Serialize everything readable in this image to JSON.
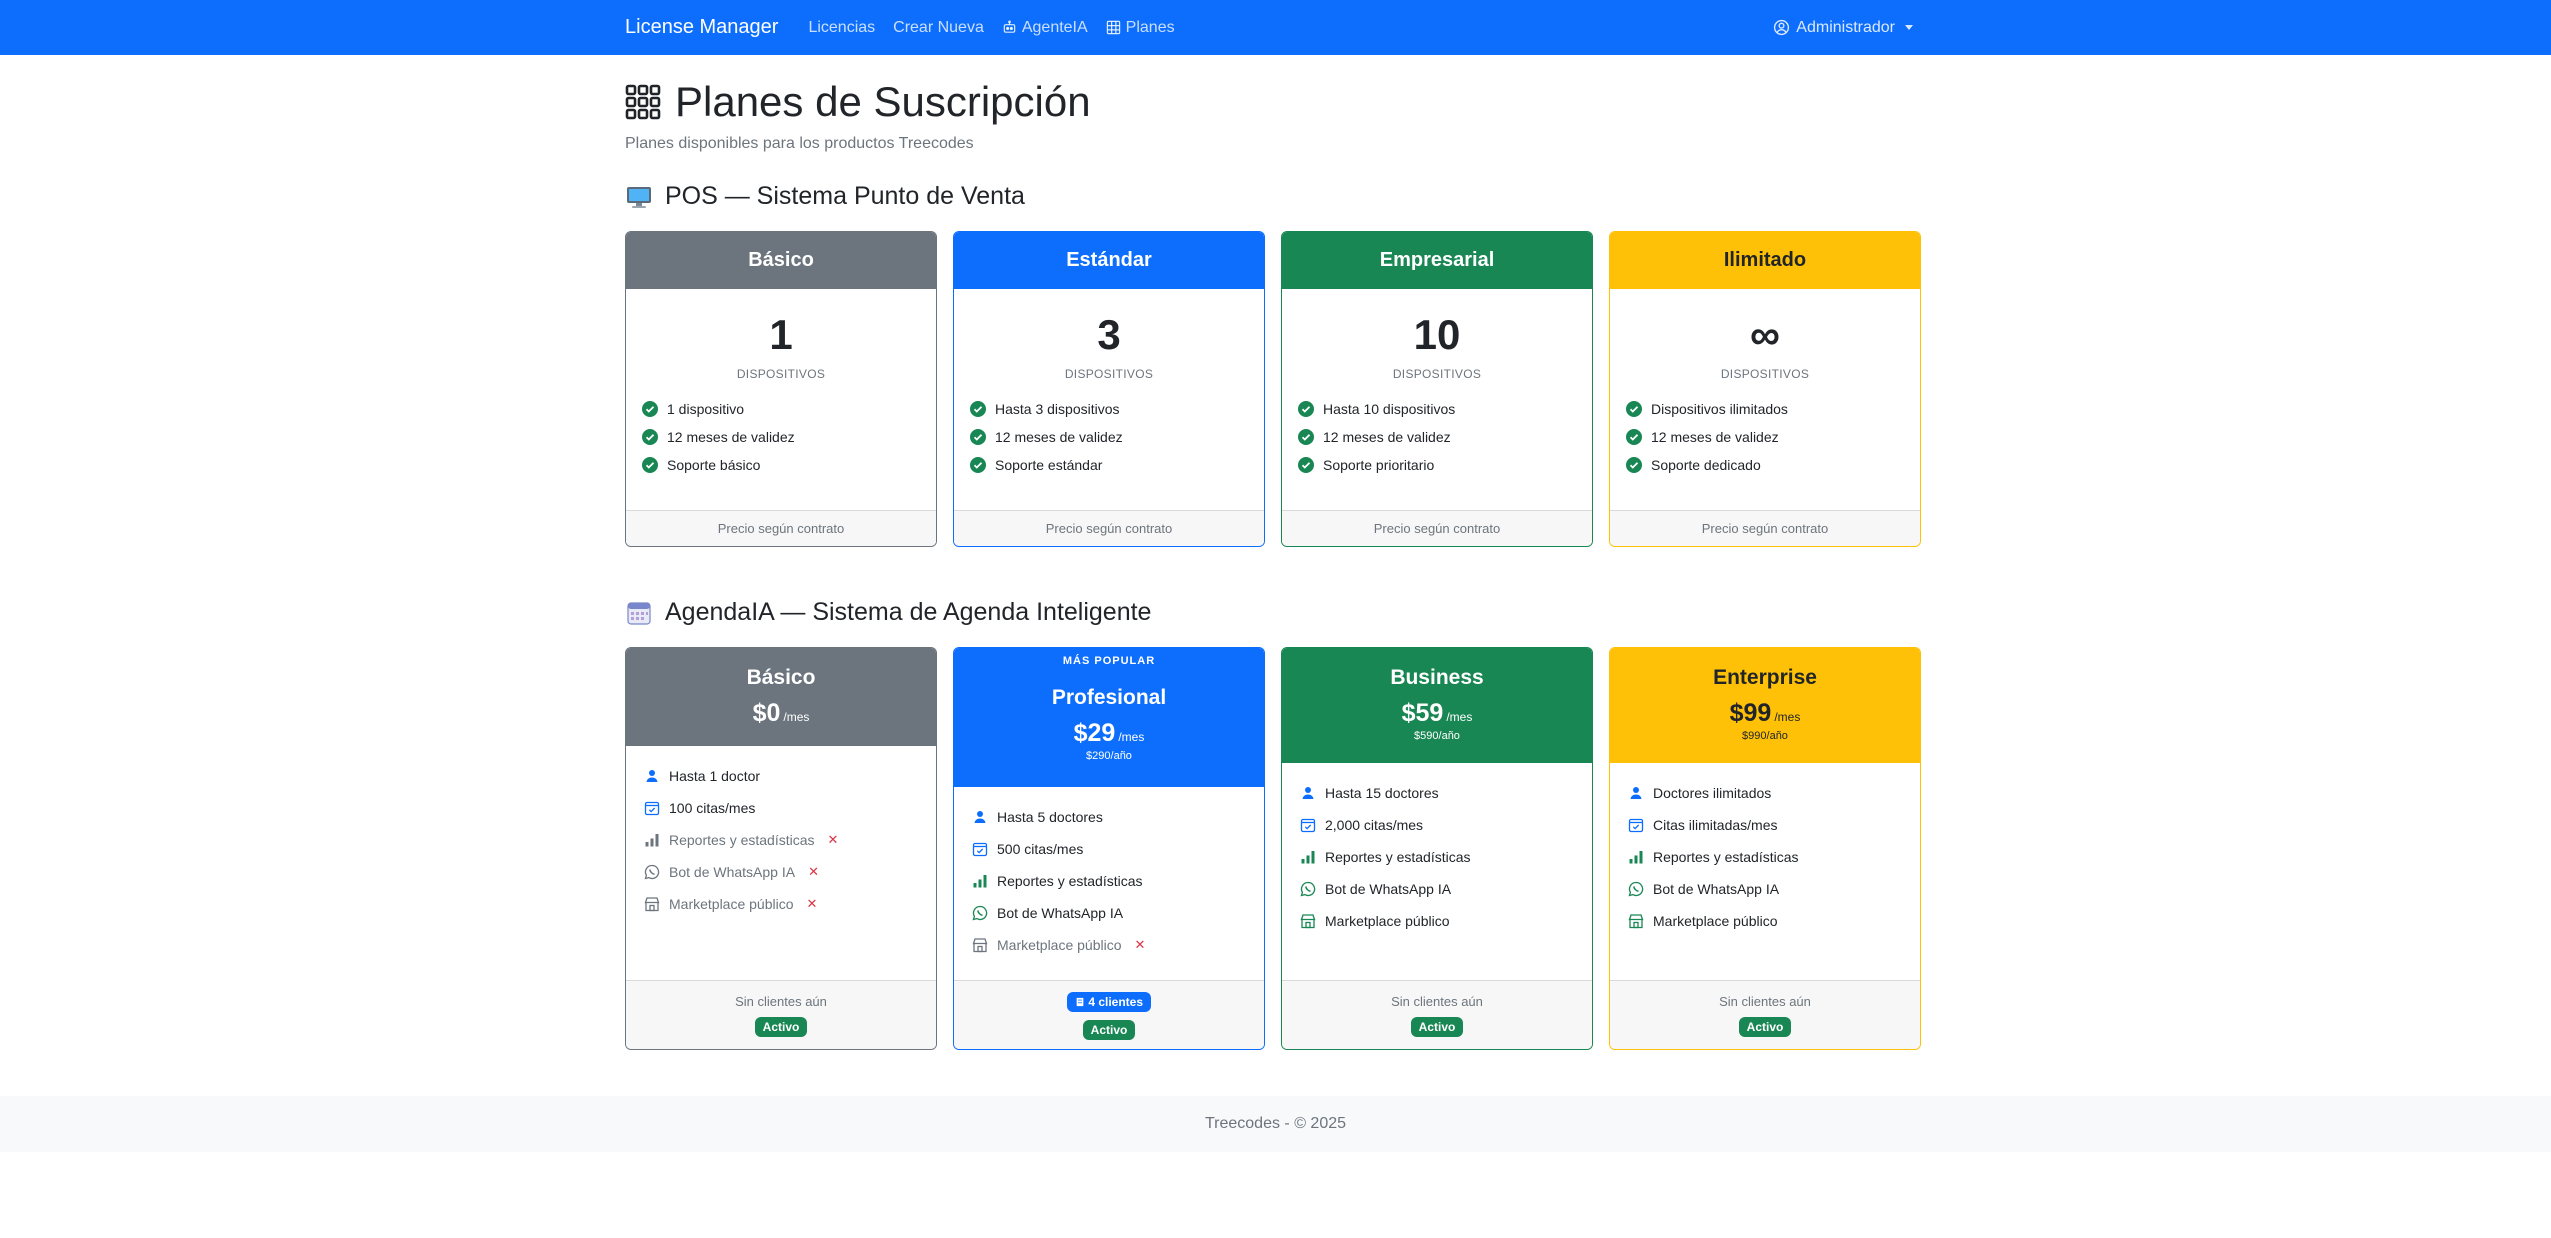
{
  "nav": {
    "brand": "License Manager",
    "links": [
      "Licencias",
      "Crear Nueva",
      "AgenteIA",
      "Planes"
    ],
    "user": "Administrador"
  },
  "header": {
    "title": "Planes de Suscripción",
    "subtitle": "Planes disponibles para los productos Treecodes"
  },
  "pos": {
    "title": "POS — Sistema Punto de Venta",
    "plans": [
      {
        "name": "Básico",
        "count": "1",
        "unit": "DISPOSITIVOS",
        "features": [
          "1 dispositivo",
          "12 meses de validez",
          "Soporte básico"
        ],
        "footer": "Precio según contrato",
        "color": "#6c757d"
      },
      {
        "name": "Estándar",
        "count": "3",
        "unit": "DISPOSITIVOS",
        "features": [
          "Hasta 3 dispositivos",
          "12 meses de validez",
          "Soporte estándar"
        ],
        "footer": "Precio según contrato",
        "color": "#0d6efd"
      },
      {
        "name": "Empresarial",
        "count": "10",
        "unit": "DISPOSITIVOS",
        "features": [
          "Hasta 10 dispositivos",
          "12 meses de validez",
          "Soporte prioritario"
        ],
        "footer": "Precio según contrato",
        "color": "#198754"
      },
      {
        "name": "Ilimitado",
        "count": "∞",
        "unit": "DISPOSITIVOS",
        "features": [
          "Dispositivos ilimitados",
          "12 meses de validez",
          "Soporte dedicado"
        ],
        "footer": "Precio según contrato",
        "color": "#ffc107"
      }
    ]
  },
  "agenda": {
    "title": "AgendaIA — Sistema de Agenda Inteligente",
    "plans": [
      {
        "name": "Básico",
        "price": "$0",
        "per": "/mes",
        "yearly": "",
        "popular": "",
        "doctors": "Hasta 1 doctor",
        "citas": "100 citas/mes",
        "reportes": "Reportes y estadísticas",
        "bot": "Bot de WhatsApp IA",
        "market": "Marketplace público",
        "clients": "Sin clientes aún",
        "status": "Activo",
        "color": "#6c757d"
      },
      {
        "name": "Profesional",
        "price": "$29",
        "per": "/mes",
        "yearly": "$290/año",
        "popular": "MÁS POPULAR",
        "doctors": "Hasta 5 doctores",
        "citas": "500 citas/mes",
        "reportes": "Reportes y estadísticas",
        "bot": "Bot de WhatsApp IA",
        "market": "Marketplace público",
        "clients": "4 clientes",
        "status": "Activo",
        "color": "#0d6efd"
      },
      {
        "name": "Business",
        "price": "$59",
        "per": "/mes",
        "yearly": "$590/año",
        "popular": "",
        "doctors": "Hasta 15 doctores",
        "citas": "2,000 citas/mes",
        "reportes": "Reportes y estadísticas",
        "bot": "Bot de WhatsApp IA",
        "market": "Marketplace público",
        "clients": "Sin clientes aún",
        "status": "Activo",
        "color": "#198754"
      },
      {
        "name": "Enterprise",
        "price": "$99",
        "per": "/mes",
        "yearly": "$990/año",
        "popular": "",
        "doctors": "Doctores ilimitados",
        "citas": "Citas ilimitadas/mes",
        "reportes": "Reportes y estadísticas",
        "bot": "Bot de WhatsApp IA",
        "market": "Marketplace público",
        "clients": "Sin clientes aún",
        "status": "Activo",
        "color": "#ffc107"
      }
    ]
  },
  "footer": "Treecodes - © 2025"
}
